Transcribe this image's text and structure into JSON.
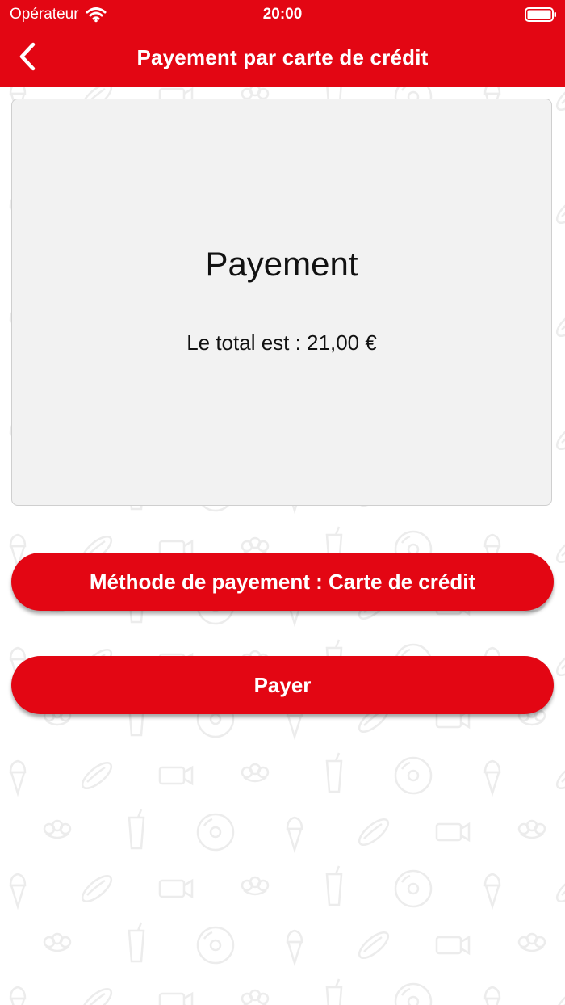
{
  "status_bar": {
    "carrier": "Opérateur",
    "time": "20:00"
  },
  "nav": {
    "title": "Payement par carte de crédit",
    "back_icon": "chevron-left-icon"
  },
  "card": {
    "title": "Payement",
    "total": "Le total est : 21,00 €"
  },
  "buttons": {
    "method": "Méthode de payement : Carte de crédit",
    "pay": "Payer"
  },
  "colors": {
    "brand_red": "#e30613",
    "card_background": "#f2f2f2",
    "pattern_stroke": "#ececec"
  },
  "background_pattern_icons": [
    "ice-cream-icon",
    "hot-dog-icon",
    "projector-icon",
    "popcorn-icon",
    "drink-cup-icon",
    "disc-icon"
  ]
}
